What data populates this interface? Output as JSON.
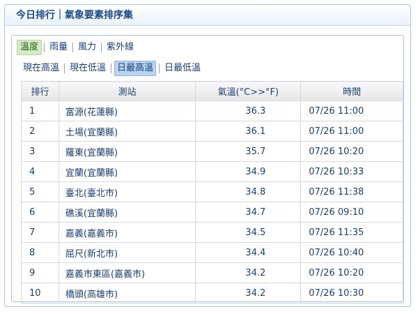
{
  "header": {
    "title": "今日排行｜氣象要素排序集"
  },
  "tabs": [
    {
      "label": "溫度",
      "active": true
    },
    {
      "label": "雨量",
      "active": false
    },
    {
      "label": "風力",
      "active": false
    },
    {
      "label": "紫外線",
      "active": false
    }
  ],
  "subtabs": [
    {
      "label": "現在高溫",
      "active": false
    },
    {
      "label": "現在低溫",
      "active": false
    },
    {
      "label": "日最高溫",
      "active": true
    },
    {
      "label": "日最低溫",
      "active": false
    }
  ],
  "table": {
    "headers": {
      "rank": "排行",
      "station": "測站",
      "temp": "氣溫(°C>>°F)",
      "time": "時間"
    },
    "rows": [
      {
        "rank": "1",
        "station": "富源(花蓮縣)",
        "temp": "36.3",
        "time": "07/26 11:00"
      },
      {
        "rank": "2",
        "station": "土場(宜蘭縣)",
        "temp": "36.1",
        "time": "07/26 11:00"
      },
      {
        "rank": "3",
        "station": "羅東(宜蘭縣)",
        "temp": "35.7",
        "time": "07/26 10:20"
      },
      {
        "rank": "4",
        "station": "宜蘭(宜蘭縣)",
        "temp": "34.9",
        "time": "07/26 10:33"
      },
      {
        "rank": "5",
        "station": "臺北(臺北市)",
        "temp": "34.8",
        "time": "07/26 11:38"
      },
      {
        "rank": "6",
        "station": "礁溪(宜蘭縣)",
        "temp": "34.7",
        "time": "07/26 09:10"
      },
      {
        "rank": "7",
        "station": "嘉義(嘉義市)",
        "temp": "34.5",
        "time": "07/26 11:35"
      },
      {
        "rank": "8",
        "station": "屈尺(新北市)",
        "temp": "34.4",
        "time": "07/26 10:40"
      },
      {
        "rank": "9",
        "station": "嘉義市東區(嘉義市)",
        "temp": "34.2",
        "time": "07/26 10:20"
      },
      {
        "rank": "10",
        "station": "橋頭(高雄市)",
        "temp": "34.2",
        "time": "07/26 10:30"
      }
    ]
  }
}
